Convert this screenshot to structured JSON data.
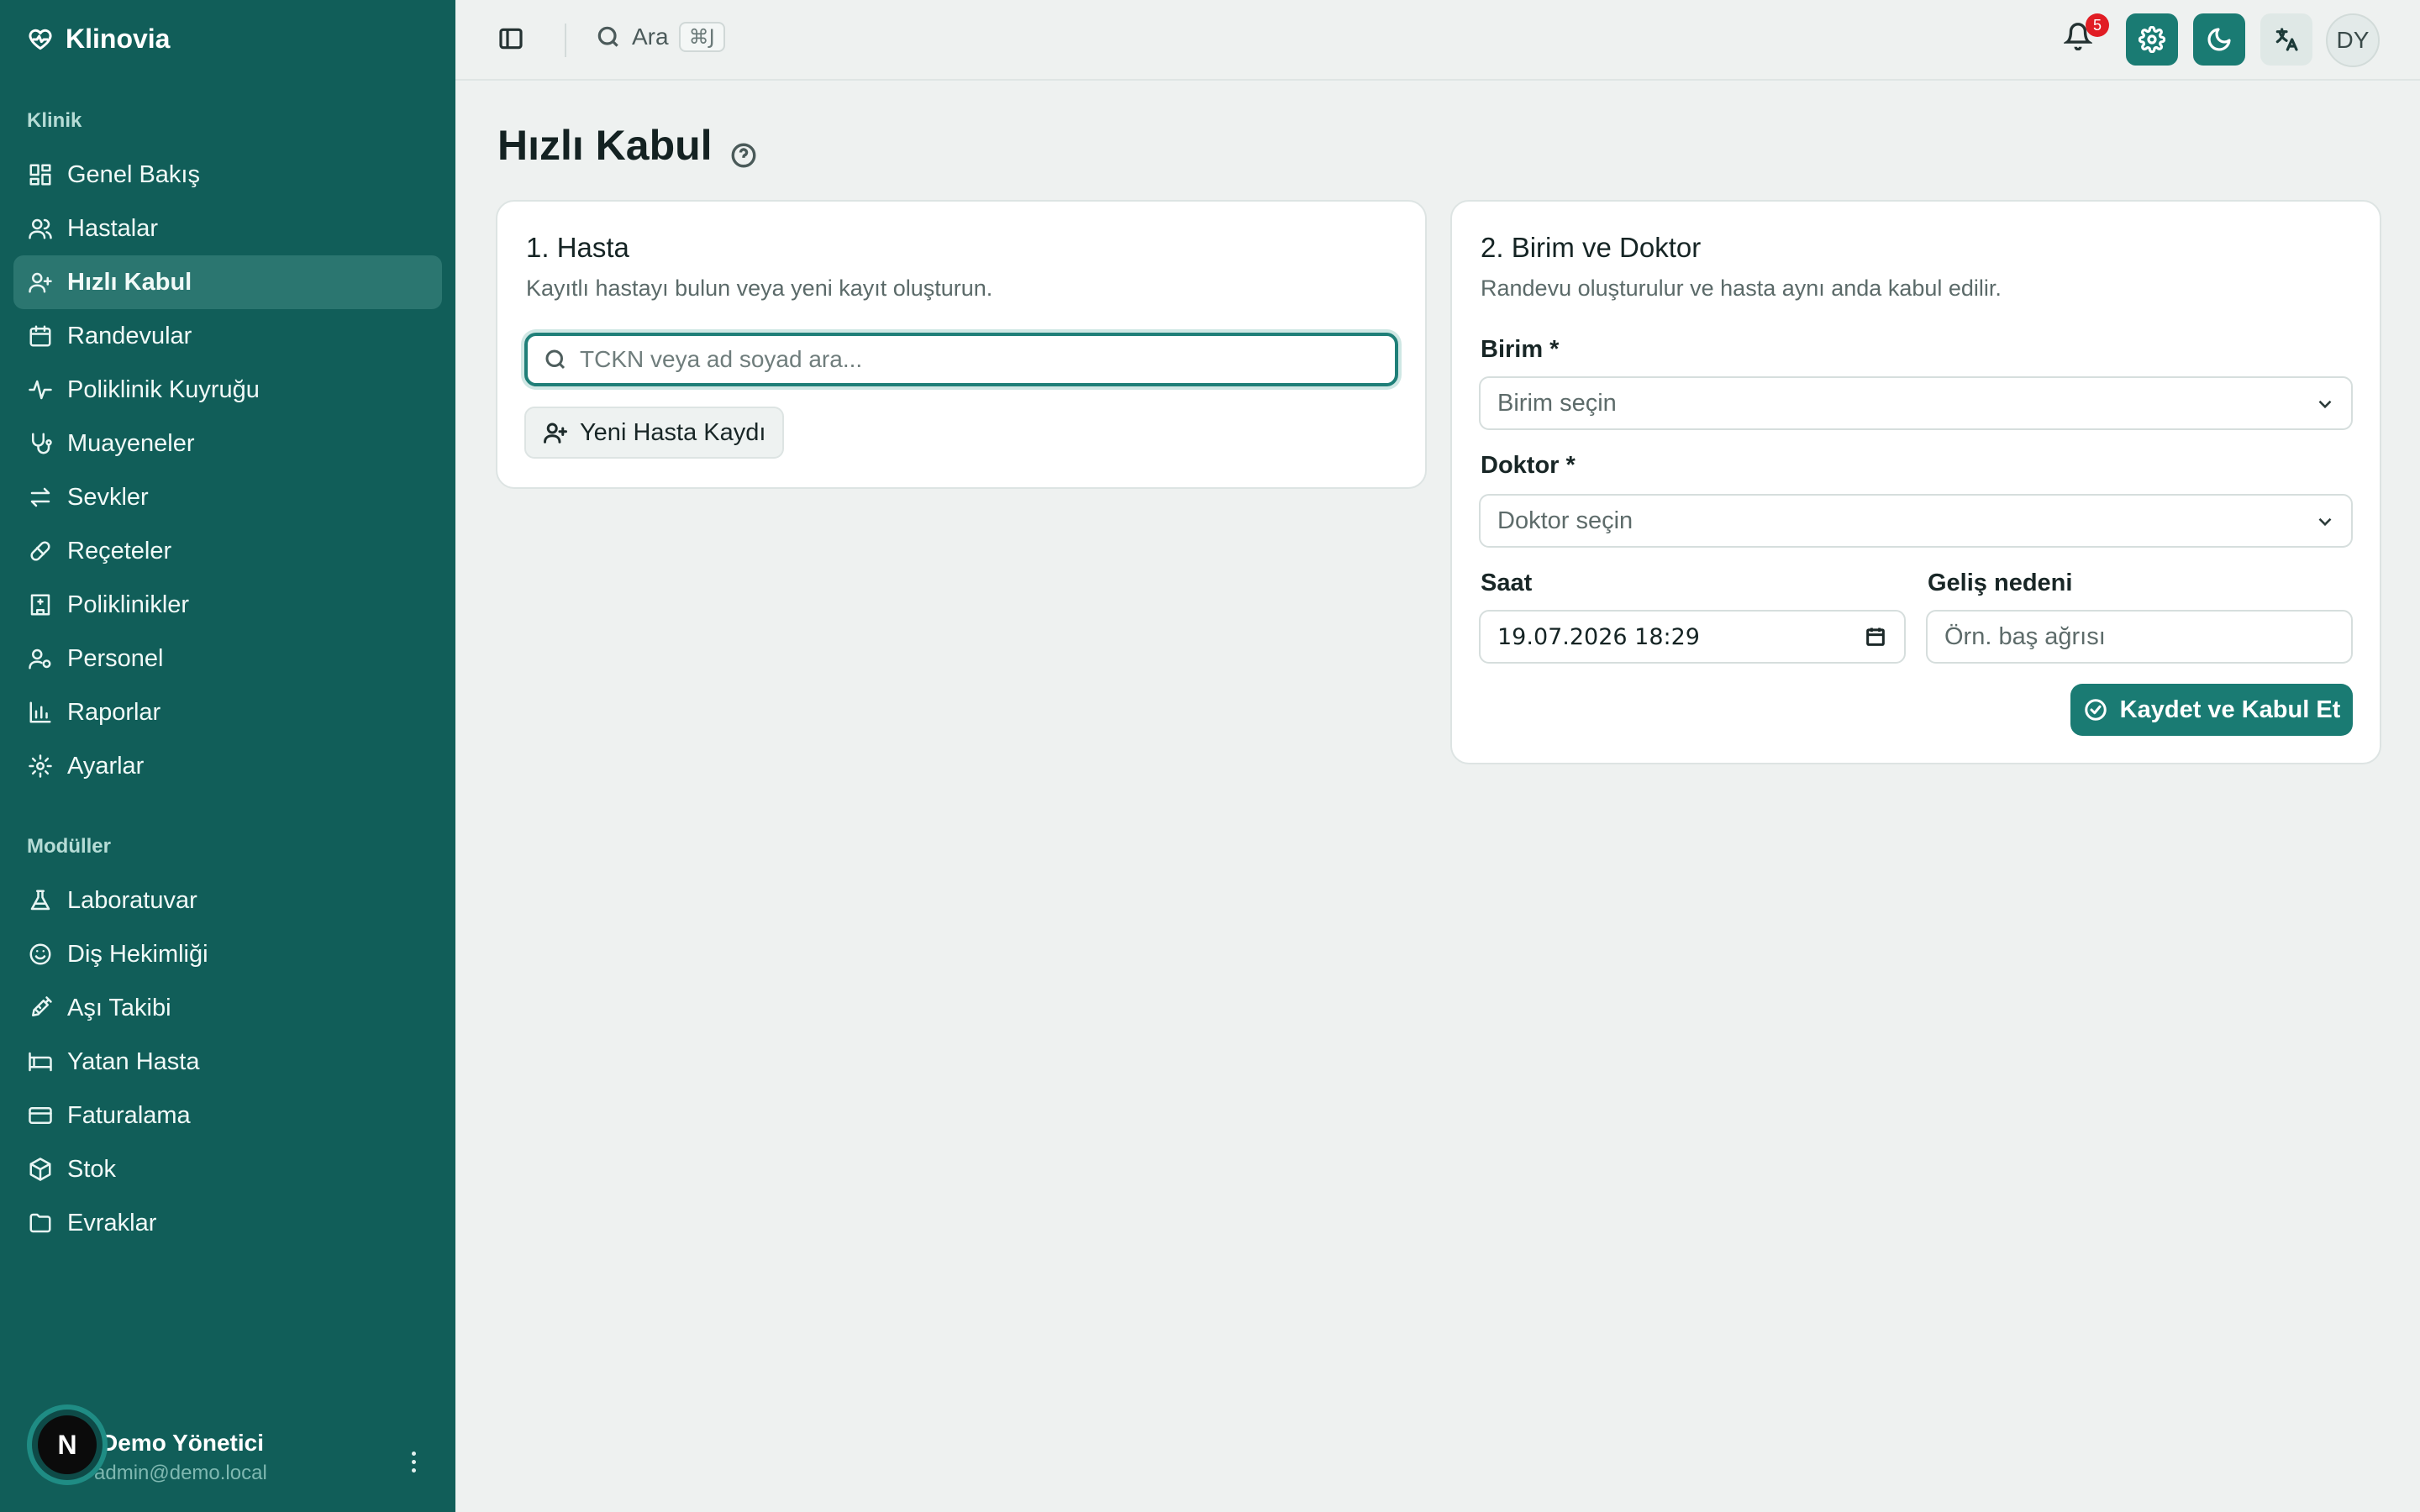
{
  "app": {
    "name": "Klinovia"
  },
  "sidebar": {
    "section_clinic": "Klinik",
    "section_modules": "Modüller",
    "clinic_items": [
      {
        "label": "Genel Bakış",
        "icon": "dashboard-icon"
      },
      {
        "label": "Hastalar",
        "icon": "users-icon"
      },
      {
        "label": "Hızlı Kabul",
        "icon": "user-plus-icon",
        "active": true
      },
      {
        "label": "Randevular",
        "icon": "calendar-icon"
      },
      {
        "label": "Poliklinik Kuyruğu",
        "icon": "activity-icon"
      },
      {
        "label": "Muayeneler",
        "icon": "stethoscope-icon"
      },
      {
        "label": "Sevkler",
        "icon": "arrows-swap-icon"
      },
      {
        "label": "Reçeteler",
        "icon": "pill-icon"
      },
      {
        "label": "Poliklinikler",
        "icon": "hospital-icon"
      },
      {
        "label": "Personel",
        "icon": "user-cog-icon"
      },
      {
        "label": "Raporlar",
        "icon": "bar-chart-icon"
      },
      {
        "label": "Ayarlar",
        "icon": "gear-icon"
      }
    ],
    "module_items": [
      {
        "label": "Laboratuvar",
        "icon": "flask-icon"
      },
      {
        "label": "Diş Hekimliği",
        "icon": "smile-icon"
      },
      {
        "label": "Aşı Takibi",
        "icon": "syringe-icon"
      },
      {
        "label": "Yatan Hasta",
        "icon": "bed-icon"
      },
      {
        "label": "Faturalama",
        "icon": "credit-card-icon"
      },
      {
        "label": "Stok",
        "icon": "package-icon"
      },
      {
        "label": "Evraklar",
        "icon": "folder-icon"
      }
    ],
    "user": {
      "avatar_letter": "N",
      "name": "Demo Yönetici",
      "email": "admin@demo.local"
    }
  },
  "topbar": {
    "search_label": "Ara",
    "search_shortcut": "⌘J",
    "notification_count": "5",
    "avatar_initials": "DY"
  },
  "page": {
    "title": "Hızlı Kabul"
  },
  "patient_card": {
    "title": "1. Hasta",
    "description": "Kayıtlı hastayı bulun veya yeni kayıt oluşturun.",
    "search_placeholder": "TCKN veya ad soyad ara...",
    "new_patient_label": "Yeni Hasta Kaydı"
  },
  "unit_card": {
    "title": "2. Birim ve Doktor",
    "description": "Randevu oluşturulur ve hasta aynı anda kabul edilir.",
    "unit_label": "Birim *",
    "unit_placeholder": "Birim seçin",
    "doctor_label": "Doktor *",
    "doctor_placeholder": "Doktor seçin",
    "time_label": "Saat",
    "time_value": "19.07.2026 18:29",
    "reason_label": "Geliş nedeni",
    "reason_placeholder": "Örn. baş ağrısı",
    "submit_label": "Kaydet ve Kabul Et"
  },
  "colors": {
    "sidebar_bg": "#115e59",
    "accent": "#1a7b73",
    "page_bg": "#eef1f0",
    "badge": "#e11d24"
  }
}
